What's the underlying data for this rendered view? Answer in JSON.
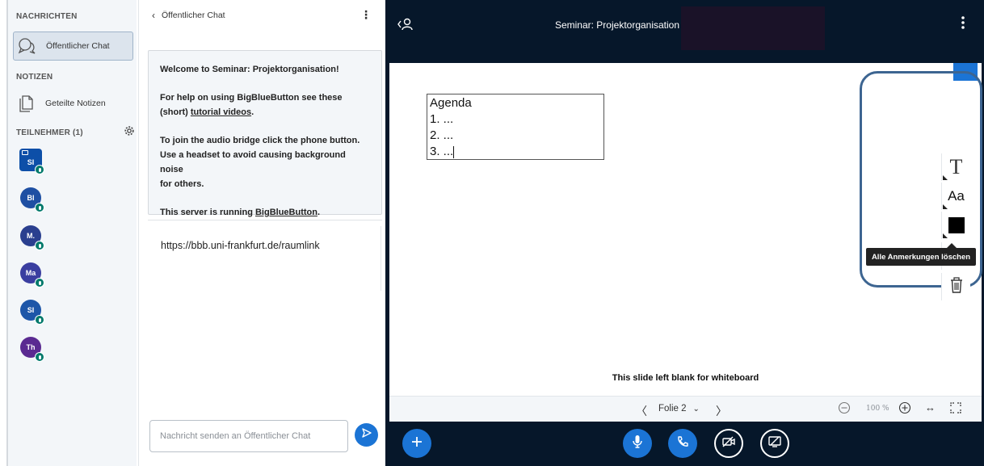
{
  "sidebar": {
    "messages_title": "NACHRICHTEN",
    "public_chat_label": "Öffentlicher Chat",
    "notes_title": "NOTIZEN",
    "shared_notes_label": "Geteilte Notizen",
    "participants_title": "TEILNEHMER (1)",
    "users": [
      {
        "initials": "SI",
        "color": "#0d4fa8",
        "presenter": true
      },
      {
        "initials": "BI",
        "color": "#1e4fa3"
      },
      {
        "initials": "M.",
        "color": "#2a3f8f"
      },
      {
        "initials": "Ma",
        "color": "#3a3ea0"
      },
      {
        "initials": "SI",
        "color": "#1d56a8"
      },
      {
        "initials": "Th",
        "color": "#5a2a91"
      }
    ]
  },
  "chat": {
    "header": "Öffentlicher Chat",
    "welcome_title": "Welcome to Seminar: Projektorganisation!",
    "help_text_1": "For help on using BigBlueButton see these",
    "help_text_2_prefix": "(short) ",
    "help_link": "tutorial videos",
    "help_text_2_suffix": ".",
    "audio_text_1": "To join the audio bridge click the phone button.",
    "audio_text_2": "Use a headset to avoid causing background noise",
    "audio_text_3": "for others.",
    "server_prefix": "This server is running ",
    "server_link": "BigBlueButton",
    "server_suffix": ".",
    "message_1": "https://bbb.uni-frankfurt.de/raumlink",
    "input_placeholder": "Nachricht senden an Öffentlicher Chat"
  },
  "main": {
    "meeting_title": "Seminar: Projektorganisation",
    "minimize_label": "–",
    "agenda_lines": [
      "Agenda",
      "1. ...",
      "2. ...",
      "3. ..."
    ],
    "slide_caption": "This slide left blank for whiteboard",
    "tooltip": "Alle Anmerkungen löschen",
    "text_tool_label": "T",
    "font_size_label": "Aa",
    "slide_label": "Folie 2",
    "zoom_level": "100 %",
    "accent_color": "#1b74d5",
    "dark_bg": "#06172a"
  }
}
